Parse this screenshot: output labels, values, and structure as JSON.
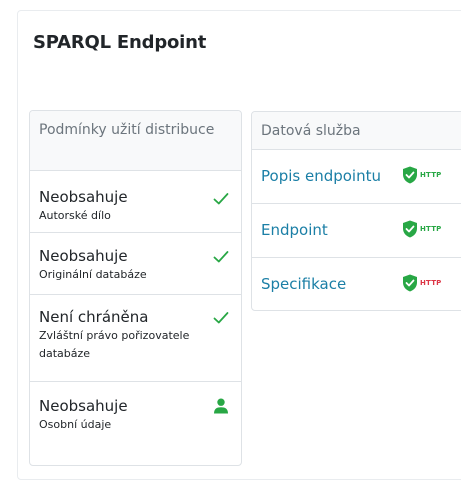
{
  "page": {
    "title": "SPARQL Endpoint"
  },
  "conditions": {
    "header": "Podmínky užití distribuce",
    "items": [
      {
        "title": "Neobsahuje",
        "subtitle": "Autorské dílo",
        "icon": "check-icon"
      },
      {
        "title": "Neobsahuje",
        "subtitle": "Originální databáze",
        "icon": "check-icon"
      },
      {
        "title": "Není chráněna",
        "subtitle": "Zvláštní právo pořizovatele databáze",
        "icon": "check-icon"
      },
      {
        "title": "Neobsahuje",
        "subtitle": "Osobní údaje",
        "icon": "person-icon"
      }
    ]
  },
  "service": {
    "header": "Datová služba",
    "links": [
      {
        "label": "Popis endpointu",
        "badge": "HTTP",
        "badge_color": "#28a745"
      },
      {
        "label": "Endpoint",
        "badge": "HTTP",
        "badge_color": "#28a745"
      },
      {
        "label": "Specifikace",
        "badge": "HTTP",
        "badge_color": "#dc3545"
      }
    ]
  },
  "colors": {
    "accent_green": "#28a745",
    "link_blue": "#1b7fa6",
    "warning_red": "#dc3545"
  }
}
